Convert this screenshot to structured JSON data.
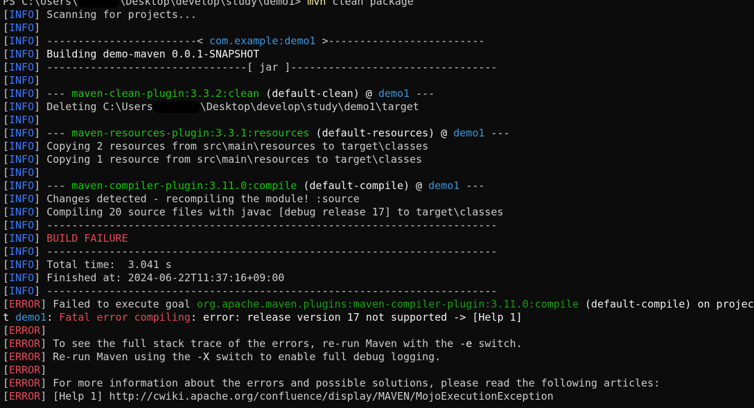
{
  "colors": {
    "background": "#0c0c0c",
    "default_text": "#cccccc",
    "bright_text": "#f2f2f2",
    "info_tag": "#3b78ff",
    "artifact": "#3a96dd",
    "plugin": "#16c60c",
    "error": "#e74856",
    "command": "#f9f1a5"
  },
  "lines": [
    [
      {
        "t": "PS C:\\Users\\",
        "c": "w"
      },
      {
        "mask": true,
        "w": 60
      },
      {
        "t": "\\Desktop\\develop\\study\\demo1> ",
        "c": "w"
      },
      {
        "t": "mvn",
        "c": "y"
      },
      {
        "t": " clean package",
        "c": "w"
      }
    ],
    [
      {
        "t": "[",
        "c": "w"
      },
      {
        "t": "INFO",
        "c": "b"
      },
      {
        "t": "] Scanning for projects...",
        "c": "w"
      }
    ],
    [
      {
        "t": "[",
        "c": "w"
      },
      {
        "t": "INFO",
        "c": "b"
      },
      {
        "t": "]",
        "c": "w"
      }
    ],
    [
      {
        "t": "[",
        "c": "w"
      },
      {
        "t": "INFO",
        "c": "b"
      },
      {
        "t": "] ------------------------< ",
        "c": "w"
      },
      {
        "t": "com.example:demo1",
        "c": "bb"
      },
      {
        "t": " >-------------------------",
        "c": "w"
      }
    ],
    [
      {
        "t": "[",
        "c": "w"
      },
      {
        "t": "INFO",
        "c": "b"
      },
      {
        "t": "] ",
        "c": "w"
      },
      {
        "t": "Building demo-maven 0.0.1-SNAPSHOT",
        "c": "bw"
      }
    ],
    [
      {
        "t": "[",
        "c": "w"
      },
      {
        "t": "INFO",
        "c": "b"
      },
      {
        "t": "] --------------------------------[ jar ]---------------------------------",
        "c": "w"
      }
    ],
    [
      {
        "t": "[",
        "c": "w"
      },
      {
        "t": "INFO",
        "c": "b"
      },
      {
        "t": "]",
        "c": "w"
      }
    ],
    [
      {
        "t": "[",
        "c": "w"
      },
      {
        "t": "INFO",
        "c": "b"
      },
      {
        "t": "] --- ",
        "c": "w"
      },
      {
        "t": "maven-clean-plugin:3.3.2:clean",
        "c": "g"
      },
      {
        "t": " (default-clean) @ ",
        "c": "bw"
      },
      {
        "t": "demo1",
        "c": "bb"
      },
      {
        "t": " ---",
        "c": "w"
      }
    ],
    [
      {
        "t": "[",
        "c": "w"
      },
      {
        "t": "INFO",
        "c": "b"
      },
      {
        "t": "] Deleting C:\\Users",
        "c": "w"
      },
      {
        "mask": true,
        "w": 68
      },
      {
        "t": "\\Desktop\\develop\\study\\demo1\\target",
        "c": "w"
      }
    ],
    [
      {
        "t": "[",
        "c": "w"
      },
      {
        "t": "INFO",
        "c": "b"
      },
      {
        "t": "]",
        "c": "w"
      }
    ],
    [
      {
        "t": "[",
        "c": "w"
      },
      {
        "t": "INFO",
        "c": "b"
      },
      {
        "t": "] --- ",
        "c": "w"
      },
      {
        "t": "maven-resources-plugin:3.3.1:resources",
        "c": "g"
      },
      {
        "t": " (default-resources) @ ",
        "c": "bw"
      },
      {
        "t": "demo1",
        "c": "bb"
      },
      {
        "t": " ---",
        "c": "w"
      }
    ],
    [
      {
        "t": "[",
        "c": "w"
      },
      {
        "t": "INFO",
        "c": "b"
      },
      {
        "t": "] Copying 2 resources from src\\main\\resources to target\\classes",
        "c": "w"
      }
    ],
    [
      {
        "t": "[",
        "c": "w"
      },
      {
        "t": "INFO",
        "c": "b"
      },
      {
        "t": "] Copying 1 resource from src\\main\\resources to target\\classes",
        "c": "w"
      }
    ],
    [
      {
        "t": "[",
        "c": "w"
      },
      {
        "t": "INFO",
        "c": "b"
      },
      {
        "t": "]",
        "c": "w"
      }
    ],
    [
      {
        "t": "[",
        "c": "w"
      },
      {
        "t": "INFO",
        "c": "b"
      },
      {
        "t": "] --- ",
        "c": "w"
      },
      {
        "t": "maven-compiler-plugin:3.11.0:compile",
        "c": "g"
      },
      {
        "t": " (default-compile) @ ",
        "c": "bw"
      },
      {
        "t": "demo1",
        "c": "bb"
      },
      {
        "t": " ---",
        "c": "w"
      }
    ],
    [
      {
        "t": "[",
        "c": "w"
      },
      {
        "t": "INFO",
        "c": "b"
      },
      {
        "t": "] Changes detected - recompiling the module! :source",
        "c": "w"
      }
    ],
    [
      {
        "t": "[",
        "c": "w"
      },
      {
        "t": "INFO",
        "c": "b"
      },
      {
        "t": "] Compiling 20 source files with javac [debug release 17] to target\\classes",
        "c": "w"
      }
    ],
    [
      {
        "t": "[",
        "c": "w"
      },
      {
        "t": "INFO",
        "c": "b"
      },
      {
        "t": "] ------------------------------------------------------------------------",
        "c": "w"
      }
    ],
    [
      {
        "t": "[",
        "c": "w"
      },
      {
        "t": "INFO",
        "c": "b"
      },
      {
        "t": "] ",
        "c": "w"
      },
      {
        "t": "BUILD FAILURE",
        "c": "r"
      }
    ],
    [
      {
        "t": "[",
        "c": "w"
      },
      {
        "t": "INFO",
        "c": "b"
      },
      {
        "t": "] ------------------------------------------------------------------------",
        "c": "w"
      }
    ],
    [
      {
        "t": "[",
        "c": "w"
      },
      {
        "t": "INFO",
        "c": "b"
      },
      {
        "t": "] Total time:  3.041 s",
        "c": "w"
      }
    ],
    [
      {
        "t": "[",
        "c": "w"
      },
      {
        "t": "INFO",
        "c": "b"
      },
      {
        "t": "] Finished at: 2024-06-22T11:37:16+09:00",
        "c": "w"
      }
    ],
    [
      {
        "t": "[",
        "c": "w"
      },
      {
        "t": "INFO",
        "c": "b"
      },
      {
        "t": "] ------------------------------------------------------------------------",
        "c": "w"
      }
    ],
    [
      {
        "t": "[",
        "c": "w"
      },
      {
        "t": "ERROR",
        "c": "r"
      },
      {
        "t": "] Failed to execute goal ",
        "c": "w"
      },
      {
        "t": "org.apache.maven.plugins:maven-compiler-plugin:3.11.0:compile",
        "c": "gd"
      },
      {
        "t": " (default-compile) on projec",
        "c": "bw"
      }
    ],
    [
      {
        "t": "t ",
        "c": "bw"
      },
      {
        "t": "demo1",
        "c": "bb"
      },
      {
        "t": ": ",
        "c": "bw"
      },
      {
        "t": "Fatal error compiling",
        "c": "r"
      },
      {
        "t": ": error: release version 17 not supported -> [Help 1]",
        "c": "bw"
      }
    ],
    [
      {
        "t": "[",
        "c": "w"
      },
      {
        "t": "ERROR",
        "c": "r"
      },
      {
        "t": "]",
        "c": "w"
      }
    ],
    [
      {
        "t": "[",
        "c": "w"
      },
      {
        "t": "ERROR",
        "c": "r"
      },
      {
        "t": "] To see the full stack trace of the errors, re-run Maven with the ",
        "c": "w"
      },
      {
        "t": "-e",
        "c": "bw"
      },
      {
        "t": " switch.",
        "c": "w"
      }
    ],
    [
      {
        "t": "[",
        "c": "w"
      },
      {
        "t": "ERROR",
        "c": "r"
      },
      {
        "t": "] Re-run Maven using the ",
        "c": "w"
      },
      {
        "t": "-X",
        "c": "bw"
      },
      {
        "t": " switch to enable full debug logging.",
        "c": "w"
      }
    ],
    [
      {
        "t": "[",
        "c": "w"
      },
      {
        "t": "ERROR",
        "c": "r"
      },
      {
        "t": "]",
        "c": "w"
      }
    ],
    [
      {
        "t": "[",
        "c": "w"
      },
      {
        "t": "ERROR",
        "c": "r"
      },
      {
        "t": "] For more information about the errors and possible solutions, please read the following articles:",
        "c": "w"
      }
    ],
    [
      {
        "t": "[",
        "c": "w"
      },
      {
        "t": "ERROR",
        "c": "r"
      },
      {
        "t": "] [Help 1] http://cwiki.apache.org/confluence/display/MAVEN/MojoExecutionException",
        "c": "w"
      }
    ]
  ]
}
